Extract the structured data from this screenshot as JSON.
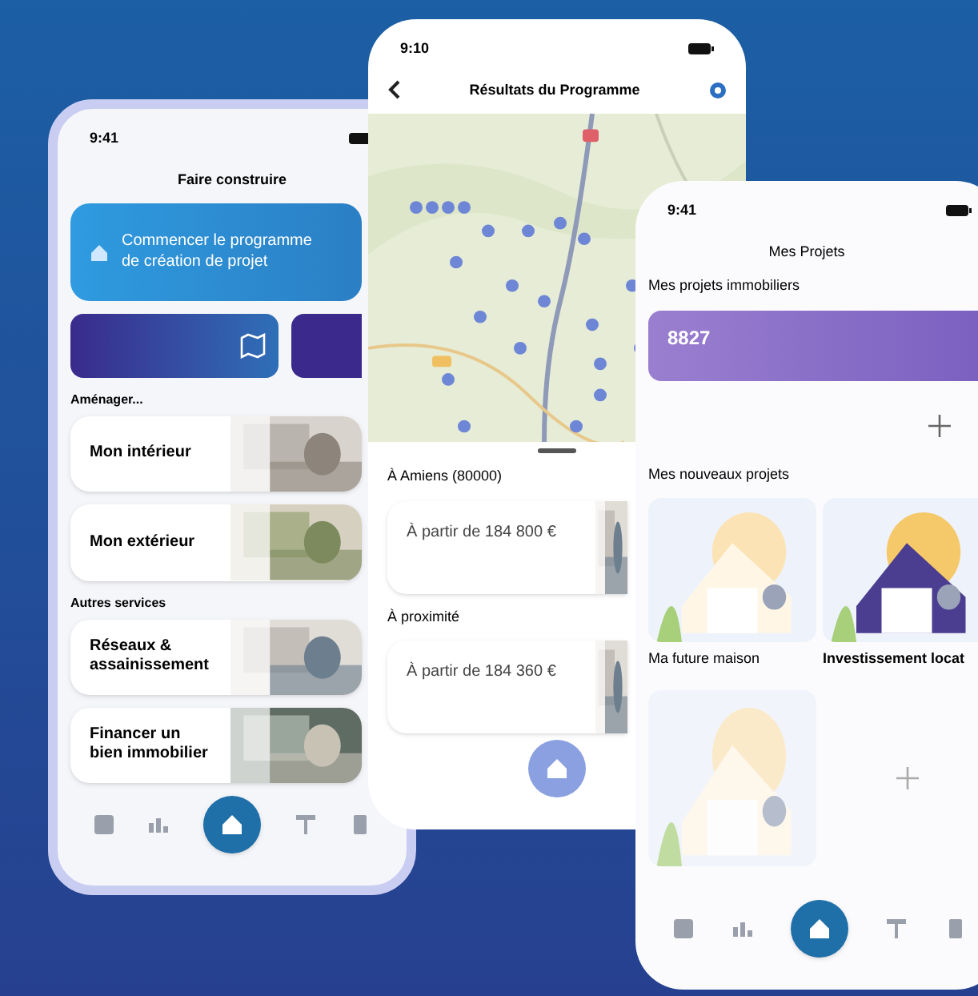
{
  "phone_build": {
    "time": "9:41",
    "title": "Faire construire",
    "banner": "Commencer le programme de création de projet",
    "section_1": "Aménager...",
    "items_1": [
      {
        "label": "Mon intérieur"
      },
      {
        "label": "Mon extérieur"
      }
    ],
    "section_2": "Autres services",
    "items_2": [
      {
        "label": "Réseaux & assainissement"
      },
      {
        "label": "Financer un bien immobilier"
      }
    ]
  },
  "phone_results": {
    "time": "9:10",
    "title": "Résultats du Programme",
    "groups": [
      {
        "heading": "À Amiens (80000)",
        "price": "À partir de 184 800 €"
      },
      {
        "heading": "À proximité",
        "price": "À partir de 184 360 €"
      }
    ]
  },
  "phone_projects": {
    "time": "9:41",
    "title": "Mes Projets",
    "section_1": "Mes projets immobiliers",
    "project_number": "8827",
    "section_2": "Mes nouveaux projets",
    "cards": [
      {
        "kind": "project",
        "label": "Ma future maison"
      },
      {
        "kind": "project",
        "label": "Investissement locat"
      },
      {
        "kind": "draft"
      },
      {
        "kind": "add"
      }
    ]
  }
}
